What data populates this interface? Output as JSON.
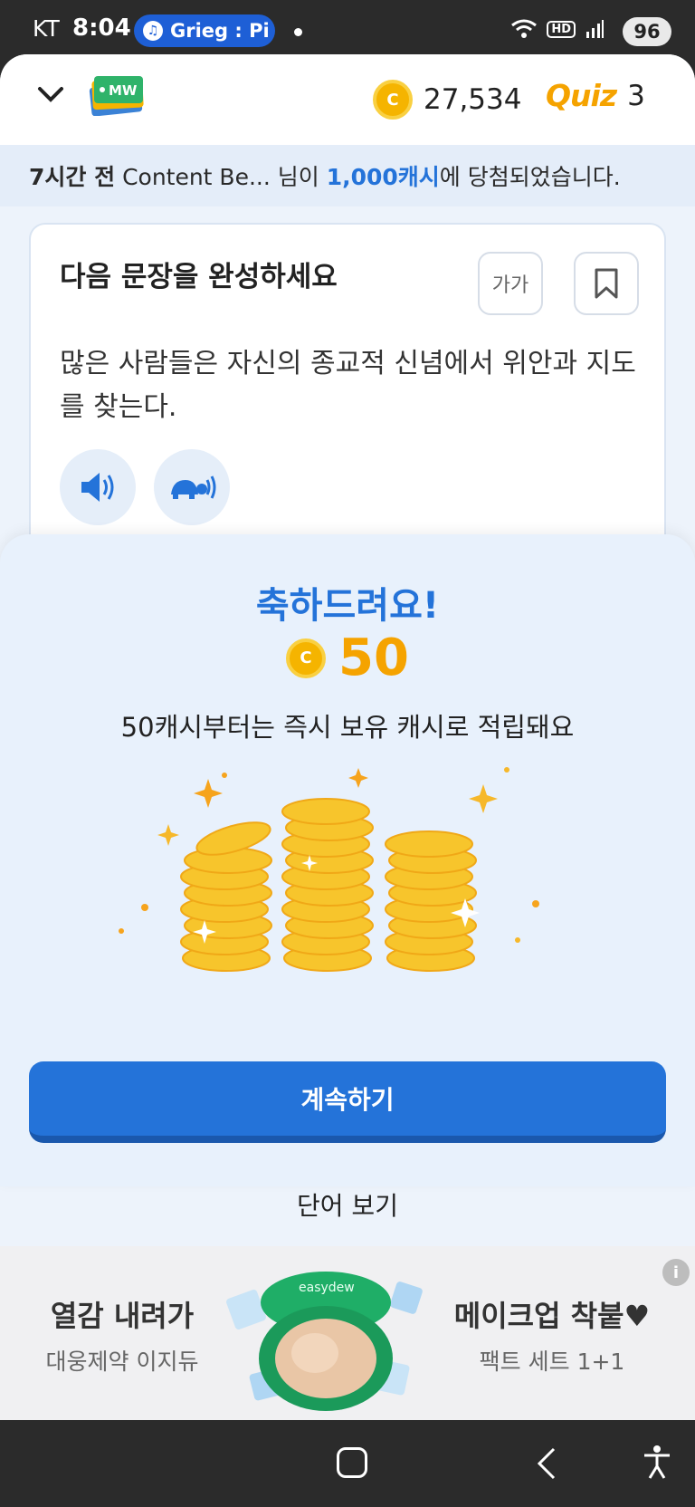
{
  "status_bar": {
    "carrier": "KT",
    "time": "8:04",
    "media_label": "Grieg : Pi",
    "hd_label": "HD",
    "battery": "96"
  },
  "header": {
    "logo_text": "MW",
    "coin_count": "27,534",
    "quiz_label": "Quiz",
    "quiz_count": "3",
    "coin_symbol": "C"
  },
  "notice": {
    "time": "7시간 전",
    "user": "Content Be...",
    "before": "님이 ",
    "amount": "1,000캐시",
    "after": "에 당첨되었습니다."
  },
  "question": {
    "title": "다음 문장을 완성하세요",
    "font_button": "가가",
    "sentence": "많은 사람들은 자신의 종교적 신념에서 위안과 지도를 찾는다."
  },
  "reward": {
    "congrats": "축하드려요!",
    "amount": "50",
    "message": "50캐시부터는 즉시 보유 캐시로 적립돼요",
    "continue_label": "계속하기",
    "view_words_label": "단어 보기"
  },
  "ad": {
    "left_title": "열감 내려가",
    "left_sub": "대웅제약 이지듀",
    "right_title": "메이크업 착붙♥",
    "right_sub": "팩트 세트 1+1",
    "info_label": "i",
    "product_brand": "easydew"
  },
  "colors": {
    "accent_blue": "#2473d9",
    "coin_gold": "#f5b400",
    "reward_orange": "#f5a300",
    "sheet_bg": "#e8f1fc"
  }
}
